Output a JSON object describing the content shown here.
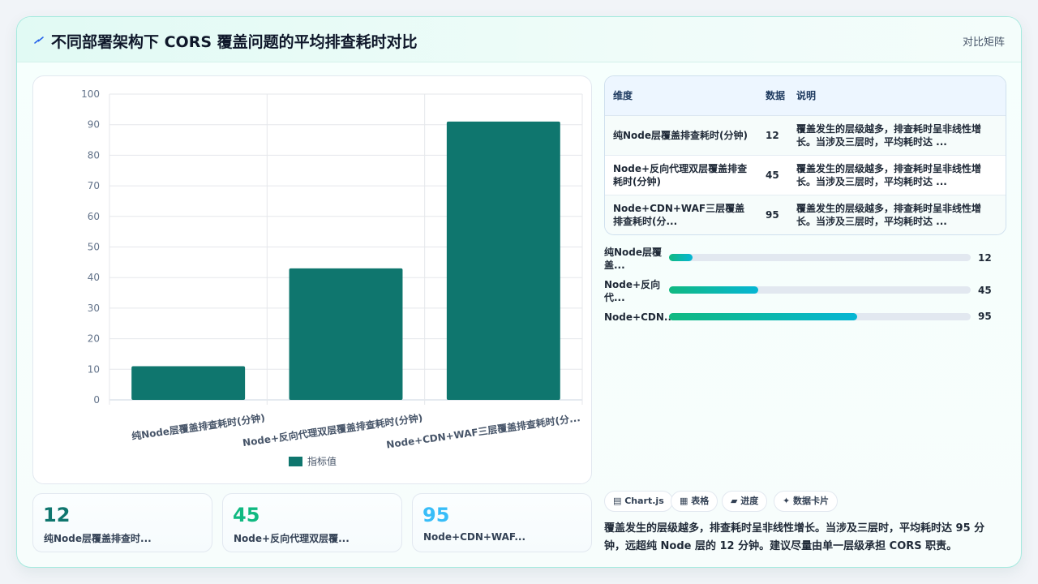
{
  "header": {
    "title": "不同部署架构下 CORS 覆盖问题的平均排查耗时对比",
    "tag": "对比矩阵"
  },
  "chart_data": {
    "type": "bar",
    "categories": [
      "纯Node层覆盖排查耗时(分钟)",
      "Node+反向代理双层覆盖排查耗时(分钟)",
      "Node+CDN+WAF三层覆盖排查耗时(分..."
    ],
    "series": [
      {
        "name": "指标值",
        "values": [
          11,
          43,
          91
        ]
      }
    ],
    "ylim": [
      0,
      100
    ],
    "yticks": [
      0,
      10,
      20,
      30,
      40,
      50,
      60,
      70,
      80,
      90,
      100
    ],
    "legend": "bottom",
    "color": "#0f766e",
    "grid": true
  },
  "stats": [
    {
      "value": "12",
      "label": "纯Node层覆盖排查时...",
      "color": "#0f766e"
    },
    {
      "value": "45",
      "label": "Node+反向代理双层覆...",
      "color": "#10b981"
    },
    {
      "value": "95",
      "label": "Node+CDN+WAF...",
      "color": "#38bdf8"
    }
  ],
  "table": {
    "headers": [
      "维度",
      "数据",
      "说明"
    ],
    "rows": [
      {
        "dim": "纯Node层覆盖排查耗时(分钟)",
        "val": "12",
        "desc": "覆盖发生的层级越多，排查耗时呈非线性增长。当涉及三层时，平均耗时达 ..."
      },
      {
        "dim": "Node+反向代理双层覆盖排查耗时(分钟)",
        "val": "45",
        "desc": "覆盖发生的层级越多，排查耗时呈非线性增长。当涉及三层时，平均耗时达 ..."
      },
      {
        "dim": "Node+CDN+WAF三层覆盖排查耗时(分...",
        "val": "95",
        "desc": "覆盖发生的层级越多，排查耗时呈非线性增长。当涉及三层时，平均耗时达 ..."
      }
    ]
  },
  "progress": [
    {
      "label": "纯Node层覆盖...",
      "value": "12",
      "fraction": 0.078
    },
    {
      "label": "Node+反向代...",
      "value": "45",
      "fraction": 0.295
    },
    {
      "label": "Node+CDN...",
      "value": "95",
      "fraction": 0.623
    }
  ],
  "chips": [
    "Chart.js",
    "表格",
    "进度",
    "数据卡片"
  ],
  "chip_icons": [
    "chart-icon",
    "table-icon",
    "progress-icon",
    "sparkle-icon"
  ],
  "summary": "覆盖发生的层级越多，排查耗时呈非线性增长。当涉及三层时，平均耗时达 95 分钟，远超纯 Node 层的 12 分钟。建议尽量由单一层级承担 CORS 职责。"
}
